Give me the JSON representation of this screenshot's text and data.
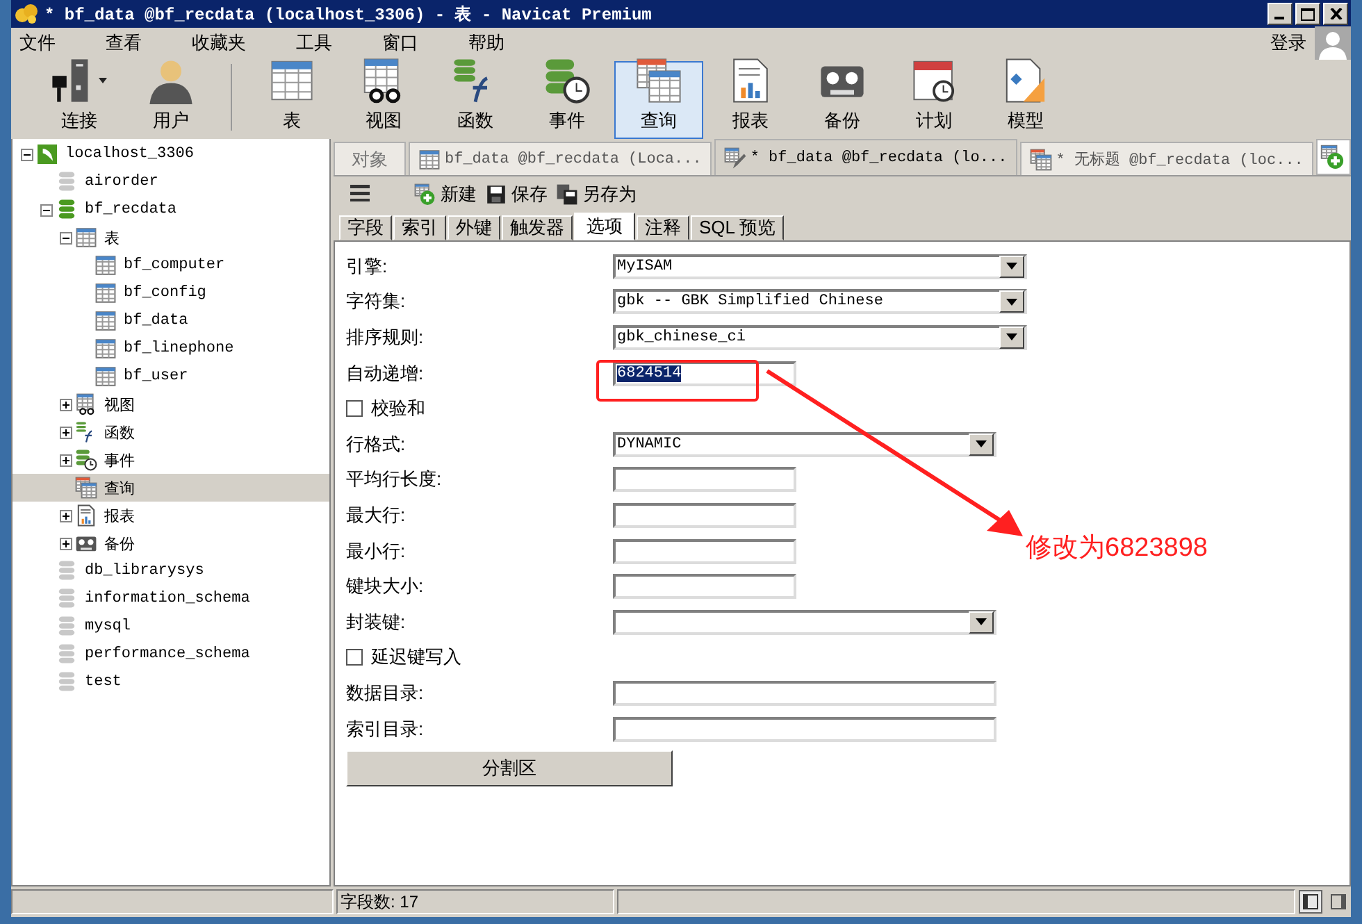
{
  "window": {
    "title": "* bf_data @bf_recdata (localhost_3306) - 表 - Navicat Premium"
  },
  "menu": [
    "文件",
    "查看",
    "收藏夹",
    "工具",
    "窗口",
    "帮助"
  ],
  "login": "登录",
  "toolbar": [
    {
      "label": "连接",
      "kind": "connection",
      "selected": false
    },
    {
      "label": "用户",
      "kind": "user",
      "selected": false
    },
    {
      "label": "表",
      "kind": "table",
      "selected": false
    },
    {
      "label": "视图",
      "kind": "view",
      "selected": false
    },
    {
      "label": "函数",
      "kind": "function",
      "selected": false
    },
    {
      "label": "事件",
      "kind": "event",
      "selected": false
    },
    {
      "label": "查询",
      "kind": "query",
      "selected": true
    },
    {
      "label": "报表",
      "kind": "report",
      "selected": false
    },
    {
      "label": "备份",
      "kind": "backup",
      "selected": false
    },
    {
      "label": "计划",
      "kind": "schedule",
      "selected": false
    },
    {
      "label": "模型",
      "kind": "model",
      "selected": false
    }
  ],
  "tree": [
    {
      "label": "localhost_3306",
      "kind": "server",
      "expanded": true,
      "selected": false,
      "children": [
        {
          "label": "airorder",
          "kind": "database",
          "selected": false
        },
        {
          "label": "bf_recdata",
          "kind": "database-open",
          "expanded": true,
          "selected": false,
          "children": [
            {
              "label": "表",
              "kind": "table",
              "expanded": true,
              "selected": false,
              "children": [
                {
                  "label": "bf_computer",
                  "kind": "table",
                  "selected": false
                },
                {
                  "label": "bf_config",
                  "kind": "table",
                  "selected": false
                },
                {
                  "label": "bf_data",
                  "kind": "table",
                  "selected": false
                },
                {
                  "label": "bf_linephone",
                  "kind": "table",
                  "selected": false
                },
                {
                  "label": "bf_user",
                  "kind": "table",
                  "selected": false
                }
              ]
            },
            {
              "label": "视图",
              "kind": "view",
              "expanded": false,
              "selected": false
            },
            {
              "label": "函数",
              "kind": "function",
              "expanded": false,
              "selected": false
            },
            {
              "label": "事件",
              "kind": "event",
              "expanded": false,
              "selected": false
            },
            {
              "label": "查询",
              "kind": "query",
              "selected": true
            },
            {
              "label": "报表",
              "kind": "report",
              "expanded": false,
              "selected": false
            },
            {
              "label": "备份",
              "kind": "backup",
              "expanded": false,
              "selected": false
            }
          ]
        },
        {
          "label": "db_librarysys",
          "kind": "database",
          "selected": false
        },
        {
          "label": "information_schema",
          "kind": "database",
          "selected": false
        },
        {
          "label": "mysql",
          "kind": "database",
          "selected": false
        },
        {
          "label": "performance_schema",
          "kind": "database",
          "selected": false
        },
        {
          "label": "test",
          "kind": "database",
          "selected": false
        }
      ]
    }
  ],
  "doc_tabs": [
    {
      "label": "对象",
      "kind": "object",
      "selected": false
    },
    {
      "label": "bf_data @bf_recdata (Loca...",
      "kind": "table",
      "selected": false
    },
    {
      "label": "* bf_data @bf_recdata (lo...",
      "kind": "table-edit",
      "selected": true
    },
    {
      "label": "* 无标题 @bf_recdata (loc...",
      "kind": "query",
      "selected": false
    }
  ],
  "editor_toolbar": [
    {
      "label": "新建",
      "kind": "new"
    },
    {
      "label": "保存",
      "kind": "save"
    },
    {
      "label": "另存为",
      "kind": "save-as"
    }
  ],
  "sub_tabs": [
    {
      "label": "字段",
      "selected": false
    },
    {
      "label": "索引",
      "selected": false
    },
    {
      "label": "外键",
      "selected": false
    },
    {
      "label": "触发器",
      "selected": false
    },
    {
      "label": "选项",
      "selected": true
    },
    {
      "label": "注释",
      "selected": false
    },
    {
      "label": "SQL 预览",
      "selected": false
    }
  ],
  "options": [
    {
      "kind": "combo",
      "label": "引擎:",
      "value": "MyISAM"
    },
    {
      "kind": "combo",
      "label": "字符集:",
      "value": "gbk -- GBK Simplified Chinese"
    },
    {
      "kind": "combo",
      "label": "排序规则:",
      "value": "gbk_chinese_ci"
    },
    {
      "kind": "text",
      "label": "自动递增:",
      "value": "6824514",
      "value_selected": true
    },
    {
      "kind": "checkbox",
      "label": "校验和",
      "checked": false
    },
    {
      "kind": "select",
      "label": "行格式:",
      "value": "DYNAMIC"
    },
    {
      "kind": "text",
      "label": "平均行长度:"
    },
    {
      "kind": "text",
      "label": "最大行:"
    },
    {
      "kind": "text",
      "label": "最小行:"
    },
    {
      "kind": "text",
      "label": "键块大小:"
    },
    {
      "kind": "select",
      "label": "封装键:"
    },
    {
      "kind": "checkbox",
      "label": "延迟键写入",
      "checked": false
    },
    {
      "kind": "wide-text",
      "label": "数据目录:"
    },
    {
      "kind": "wide-text",
      "label": "索引目录:"
    }
  ],
  "partition_button": "分割区",
  "status_bar": {
    "field_count": "字段数: 17"
  },
  "annotation": {
    "note": "修改为6823898"
  }
}
